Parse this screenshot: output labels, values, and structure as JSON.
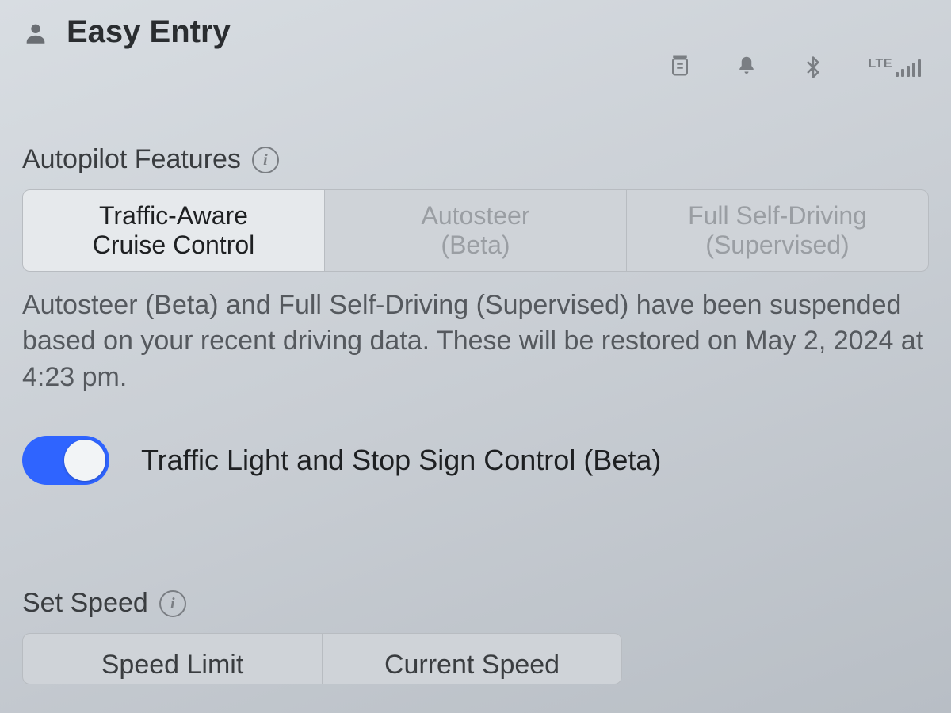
{
  "header": {
    "profile_label": "Easy Entry",
    "network_label": "LTE"
  },
  "autopilot": {
    "section_title": "Autopilot Features",
    "options": {
      "tacc": "Traffic-Aware\nCruise Control",
      "autosteer": "Autosteer\n(Beta)",
      "fsd": "Full Self-Driving\n(Supervised)"
    },
    "suspension_notice": "Autosteer (Beta) and Full Self-Driving (Supervised) have been suspended based on your recent driving data.\nThese will be restored on May 2, 2024 at 4:23 pm."
  },
  "traffic_light": {
    "label": "Traffic Light and Stop Sign Control (Beta)",
    "enabled": true
  },
  "set_speed": {
    "section_title": "Set Speed",
    "options": {
      "speed_limit": "Speed Limit",
      "current_speed": "Current Speed"
    }
  }
}
